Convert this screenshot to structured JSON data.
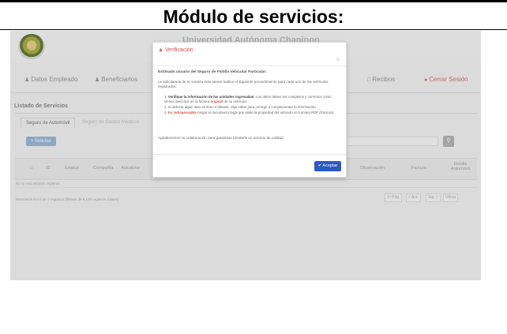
{
  "slide": {
    "title": "Módulo de servicios:"
  },
  "app": {
    "title": "Universidad Autónoma Chapingo"
  },
  "nav": {
    "datos_empleado": "Datos Empleado",
    "beneficiarios": "Beneficiarios",
    "recibos": "Recibos",
    "cerrar_sesion": "Cerrar Sesión"
  },
  "list": {
    "title": "Listado de Servicios",
    "tabs": [
      "Seguro de Automóvil",
      "Seguro de Gastos Médicos"
    ],
    "add_button": "+ Solicitar",
    "search_placeholder": "Buscar...",
    "columns": [
      "ID",
      "Estatus",
      "Compañía",
      "Actualizar",
      "Observación",
      "Factura",
      "Detalle Automóvil"
    ],
    "empty_message": "No se encontraron registros",
    "showing": "Mostrando 0 a 0 de 0 registros (filtrado de 5,149 registros totales)",
    "pager": [
      "1ª Pág.",
      "« Ant.",
      "Sig. »",
      "Últma"
    ]
  },
  "modal": {
    "title": "Verificación",
    "greeting": "Estimado usuario del Seguro de Flotilla Vehicular Particular:",
    "intro": "Le solicitamos de la manera más atenta realice el siguiente procedimiento para cada uno de los vehículos registrados:",
    "steps": [
      {
        "n": "1.",
        "bold": "Verifique la información de las unidades ingresadas:",
        "pre_red": " Los datos deben ser completos y correctos como vienen descritos en la factura ",
        "red": "original",
        "post": " de su vehículo."
      },
      {
        "n": "2.",
        "bold": "",
        "pre_red": "Si detecta algún dato erróneo o faltante, elija editar para corregir o complementar la información.",
        "red": "",
        "post": ""
      },
      {
        "n": "3.",
        "bold": "",
        "pre_red": "",
        "red": "Es indispensable",
        "post": " cargar el documento legal que avale la propiedad del vehículo en formato PDF (Factura)."
      }
    ],
    "thanks": "Agradecemos su colaboración para garantizar brindarle un servicio de calidad.",
    "accept": "✔ Aceptar",
    "close": "×"
  }
}
